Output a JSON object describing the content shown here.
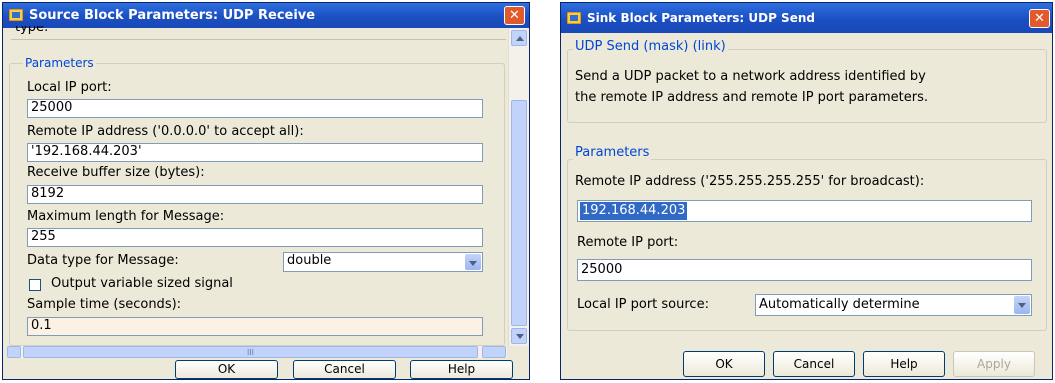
{
  "left_dialog": {
    "title": "Source Block Parameters: UDP Receive",
    "close_glyph": "✕",
    "clipped_top_text": "type:",
    "group_label": "Parameters",
    "local_port_label": "Local IP port:",
    "local_port_value": "25000",
    "remote_addr_label": "Remote IP address ('0.0.0.0' to accept all):",
    "remote_addr_value": "'192.168.44.203'",
    "buffer_label": "Receive buffer size (bytes):",
    "buffer_value": "8192",
    "maxlen_label": "Maximum length for Message:",
    "maxlen_value": "255",
    "datatype_label": "Data type for Message:",
    "datatype_value": "double",
    "varsize_label": "Output variable sized signal",
    "varsize_checked": false,
    "sample_label": "Sample time (seconds):",
    "sample_value": "0.1",
    "hscroll_grip": "III",
    "buttons": {
      "ok": "OK",
      "cancel": "Cancel",
      "help": "Help"
    }
  },
  "right_dialog": {
    "title": "Sink Block Parameters: UDP Send",
    "close_glyph": "✕",
    "mask_header": "UDP Send (mask) (link)",
    "description_line1": "Send a UDP packet to a network address identified by",
    "description_line2": "the remote IP address and remote IP port parameters.",
    "group_label": "Parameters",
    "remote_addr_label": "Remote IP address ('255.255.255.255' for broadcast):",
    "remote_addr_value": "192.168.44.203",
    "remote_port_label": "Remote IP port:",
    "remote_port_value": "25000",
    "local_source_label": "Local IP port source:",
    "local_source_value": "Automatically determine",
    "buttons": {
      "ok": "OK",
      "cancel": "Cancel",
      "help": "Help",
      "apply": "Apply"
    }
  },
  "colors": {
    "title_bar": "#1b4fc2",
    "dialog_bg": "#ece9d8",
    "group_label": "#0046d5",
    "selection": "#316ac5",
    "close_button": "#e05a2a"
  }
}
